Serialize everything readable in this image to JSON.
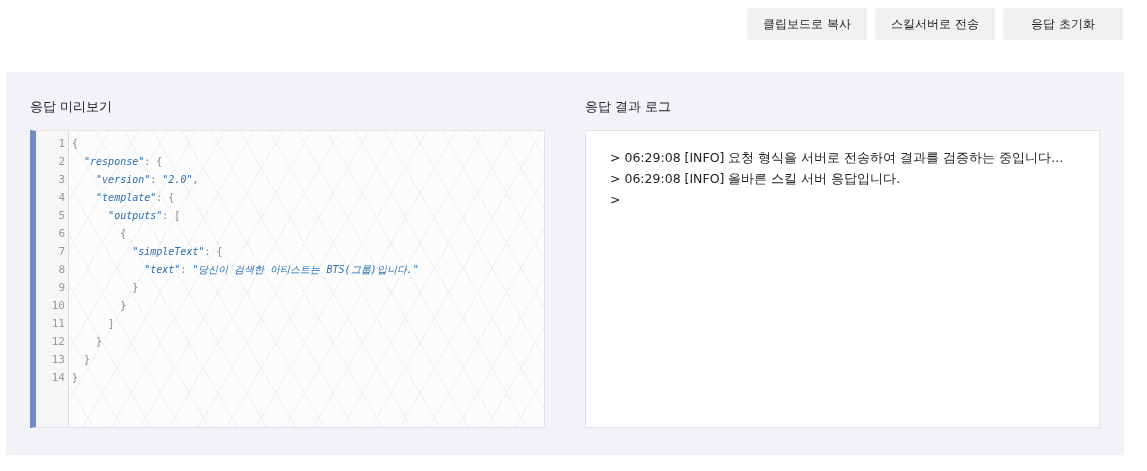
{
  "toolbar": {
    "buttons": [
      "클립보드로 복사",
      "스킬서버로 전송",
      "응답 초기화"
    ]
  },
  "preview": {
    "title": "응답 미리보기",
    "lines": [
      {
        "number": "1",
        "tokens": [
          {
            "kind": "punct",
            "text": "{"
          }
        ]
      },
      {
        "number": "2",
        "tokens": [
          {
            "kind": "key",
            "text": "  \"response\""
          },
          {
            "kind": "punct",
            "text": ": {"
          }
        ]
      },
      {
        "number": "3",
        "tokens": [
          {
            "kind": "key",
            "text": "    \"version\""
          },
          {
            "kind": "punct",
            "text": ": "
          },
          {
            "kind": "string",
            "text": "\"2.0\""
          },
          {
            "kind": "punct",
            "text": ","
          }
        ]
      },
      {
        "number": "4",
        "tokens": [
          {
            "kind": "key",
            "text": "    \"template\""
          },
          {
            "kind": "punct",
            "text": ": {"
          }
        ]
      },
      {
        "number": "5",
        "tokens": [
          {
            "kind": "key",
            "text": "      \"outputs\""
          },
          {
            "kind": "punct",
            "text": ": ["
          }
        ]
      },
      {
        "number": "6",
        "tokens": [
          {
            "kind": "punct",
            "text": "        {"
          }
        ]
      },
      {
        "number": "7",
        "tokens": [
          {
            "kind": "key",
            "text": "          \"simpleText\""
          },
          {
            "kind": "punct",
            "text": ": {"
          }
        ]
      },
      {
        "number": "8",
        "tokens": [
          {
            "kind": "key",
            "text": "            \"text\""
          },
          {
            "kind": "punct",
            "text": ": "
          },
          {
            "kind": "string",
            "text": "\"당신이 검색한 아티스트는 BTS(그룹)입니다.\""
          }
        ]
      },
      {
        "number": "9",
        "tokens": [
          {
            "kind": "punct",
            "text": "          }"
          }
        ]
      },
      {
        "number": "10",
        "tokens": [
          {
            "kind": "punct",
            "text": "        }"
          }
        ]
      },
      {
        "number": "11",
        "tokens": [
          {
            "kind": "punct",
            "text": "      ]"
          }
        ]
      },
      {
        "number": "12",
        "tokens": [
          {
            "kind": "punct",
            "text": "    }"
          }
        ]
      },
      {
        "number": "13",
        "tokens": [
          {
            "kind": "punct",
            "text": "  }"
          }
        ]
      },
      {
        "number": "14",
        "tokens": [
          {
            "kind": "punct",
            "text": "}"
          }
        ]
      }
    ]
  },
  "log": {
    "title": "응답 결과 로그",
    "lines": [
      "> 06:29:08 [INFO] 요청 형식을 서버로 전송하여 결과를 검증하는 중입니다...",
      "> 06:29:08 [INFO] 올바른 스킬 서버 응답입니다.",
      ">"
    ]
  }
}
